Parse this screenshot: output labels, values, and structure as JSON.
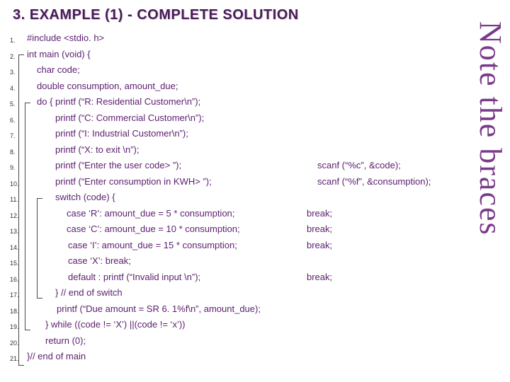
{
  "title": "3. EXAMPLE (1) - COMPLETE SOLUTION",
  "sidebar": "Note the braces",
  "lines": {
    "l1": {
      "text": "#include <stdio. h>",
      "indent": 0
    },
    "l2": {
      "text": "int main (void) {",
      "indent": 0
    },
    "l3": {
      "text": "char code;",
      "indent": 1
    },
    "l4": {
      "text": "double consumption, amount_due;",
      "indent": 1
    },
    "l5": {
      "text": "do { printf (“R: Residential Customer\\n”);",
      "indent": 1,
      "right": ""
    },
    "l6": {
      "text": "printf (“C: Commercial Customer\\n”);",
      "indent": 3
    },
    "l7": {
      "text": "printf (“I: Industrial Customer\\n”);",
      "indent": 3
    },
    "l8": {
      "text": "printf (“X: to exit \\n”);",
      "indent": 3
    },
    "l9": {
      "text": "printf (“Enter the user code> ”);",
      "indent": 3,
      "right": "scanf (“%c”, &code);"
    },
    "l10": {
      "text": "printf (“Enter consumption in KWH> ”);",
      "indent": 3,
      "right": "scanf (“%f”, &consumption);"
    },
    "l11": {
      "text": "switch (code) {",
      "indent": 3
    },
    "l12": {
      "text": "case ‘R’: amount_due = 5 * consumption;",
      "indent": 4,
      "brk": " break;"
    },
    "l13": {
      "text": "case ‘C’: amount_due = 10 * consumption;",
      "indent": 4,
      "brk": "break;"
    },
    "l14": {
      "text": "case ‘I’: amount_due = 15 * consumption;",
      "indent": 4,
      "brk": "break;"
    },
    "l15": {
      "text": "case ‘X’: break;",
      "indent": 4
    },
    "l16": {
      "text": "default : printf (“Invalid input \\n”);",
      "indent": 4,
      "brk": "break;"
    },
    "l17": {
      "text": "} // end of switch",
      "indent": 3
    },
    "l18": {
      "text": "printf (“Due amount = SR 6. 1%f\\n”, amount_due);",
      "indent": 3
    },
    "l19": {
      "text": "} while ((code != ‘X’) ||(code != ‘x’))",
      "indent": 2
    },
    "l20": {
      "text": "return (0);",
      "indent": 2
    },
    "l21": {
      "text": "}// end of main",
      "indent": 0
    }
  }
}
